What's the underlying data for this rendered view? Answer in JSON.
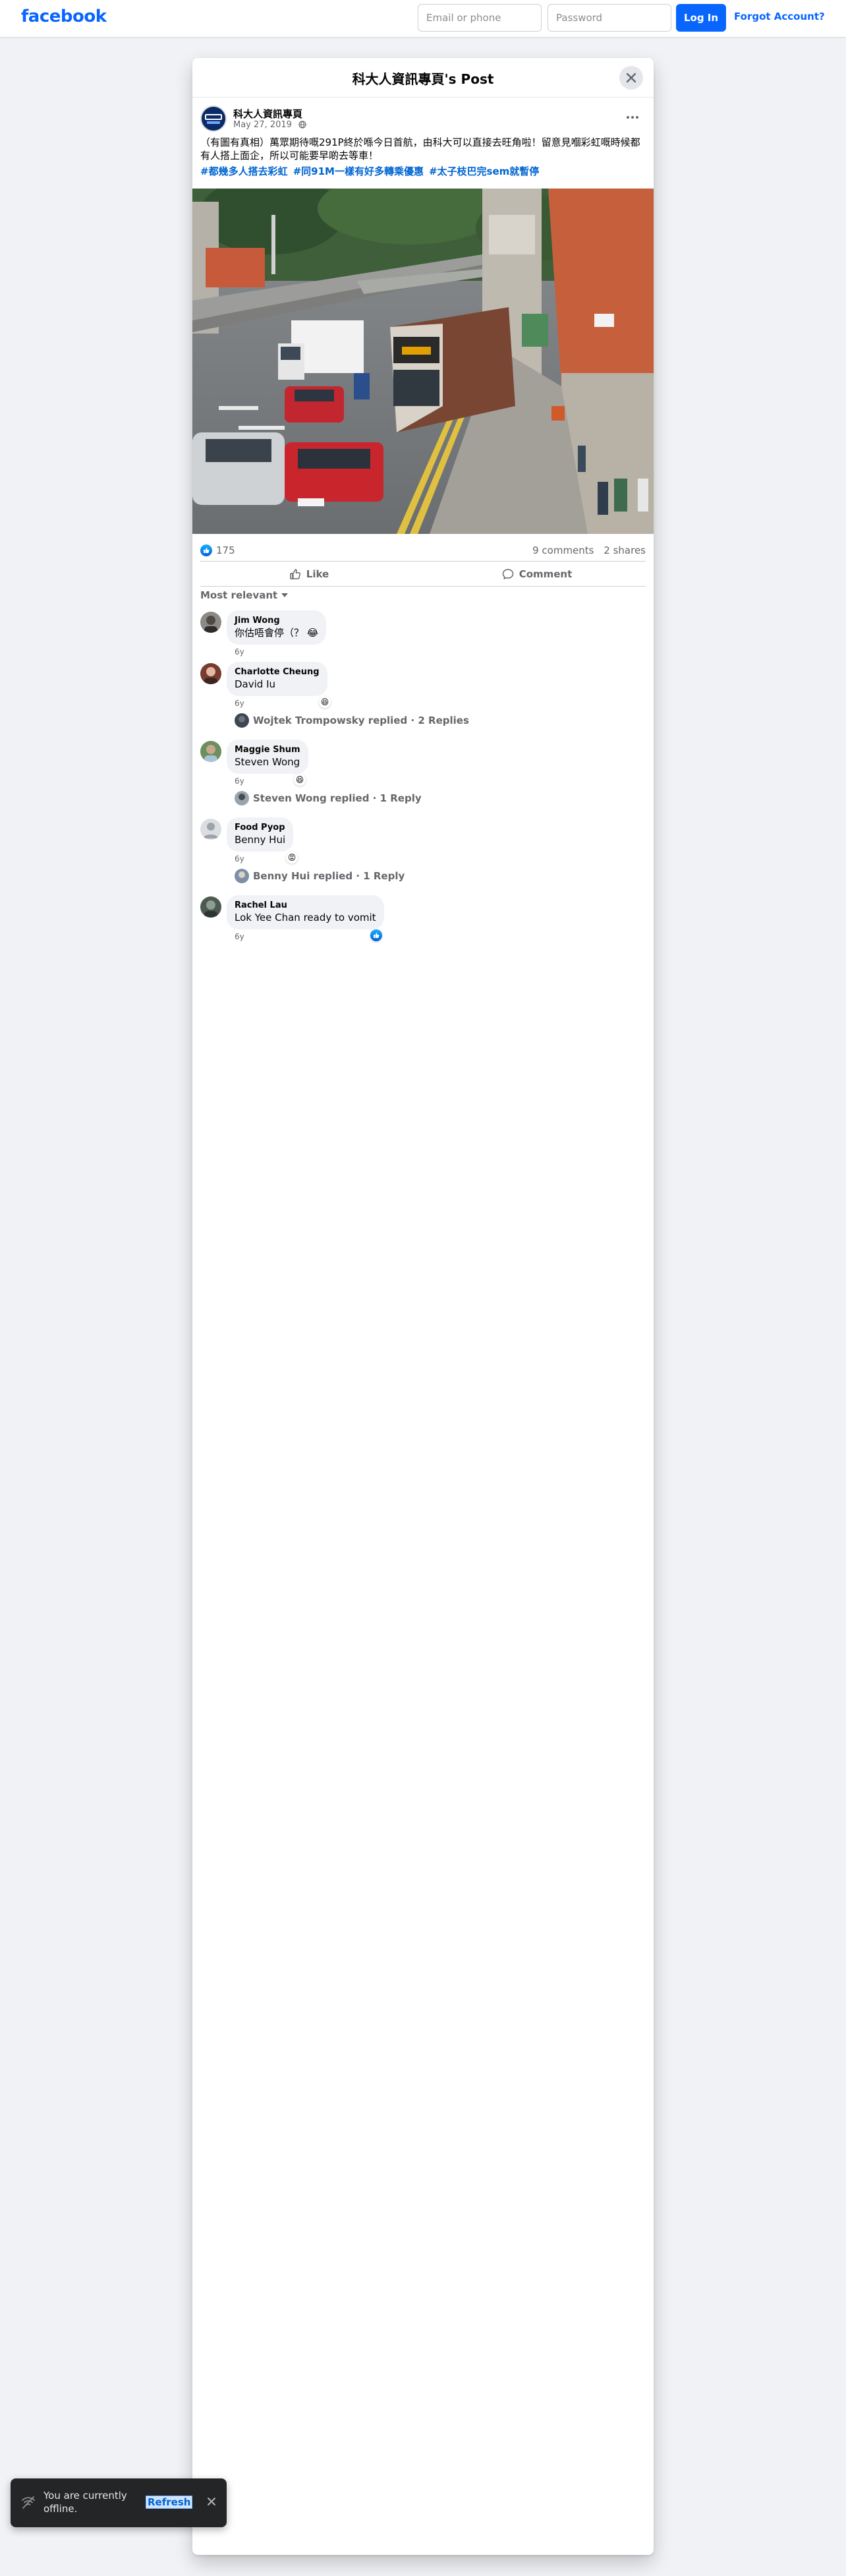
{
  "topbar": {
    "logo": "facebook",
    "email_placeholder": "Email or phone",
    "password_placeholder": "Password",
    "login_label": "Log In",
    "forgot_label": "Forgot Account?"
  },
  "dialog": {
    "title": "科大人資訊專頁's Post",
    "close_icon": "close-icon"
  },
  "post": {
    "page_name": "科大人資訊專頁",
    "avatar_text": "科大人",
    "date": "May 27, 2019",
    "privacy_icon": "globe-icon",
    "text": "（有圖有真相）萬眾期待嘅291P終於喺今日首航，由科大可以直接去旺角啦！留意見嗰彩虹嘅時候都有人搭上面企，所以可能要早啲去等車！",
    "hashtags": [
      "#都幾多人搭去彩虹",
      "#同91M一樣有好多轉乘優惠",
      "#太子枝巴完sem就暫停"
    ],
    "reaction_count": "175",
    "comments_count": "9 comments",
    "shares_count": "2 shares",
    "like_label": "Like",
    "comment_label": "Comment",
    "sort_label": "Most relevant"
  },
  "comments": [
    {
      "author": "Jim Wong",
      "text": "你估唔會停（？",
      "time": "6y",
      "reaction": "haha"
    },
    {
      "author": "Charlotte Cheung",
      "text": "David Iu",
      "time": "6y",
      "reaction": "haha",
      "replies": "Wojtek Trompowsky replied · 2 Replies"
    },
    {
      "author": "Maggie Shum",
      "text": "Steven Wong",
      "time": "6y",
      "reaction": "haha",
      "replies": "Steven Wong replied · 1 Reply"
    },
    {
      "author": "Food Pyop",
      "text": "Benny Hui",
      "time": "6y",
      "reaction": "angry",
      "replies": "Benny Hui replied · 1 Reply"
    },
    {
      "author": "Rachel Lau",
      "text": "Lok Yee Chan ready to vomit",
      "time": "6y",
      "reaction": "like"
    }
  ],
  "toast": {
    "message": "You are currently offline.",
    "refresh_label": "Refresh"
  },
  "colors": {
    "brand": "#0866ff",
    "link": "#0064d1",
    "page_bg": "#f0f2f5",
    "secondary_text": "#65676b"
  }
}
